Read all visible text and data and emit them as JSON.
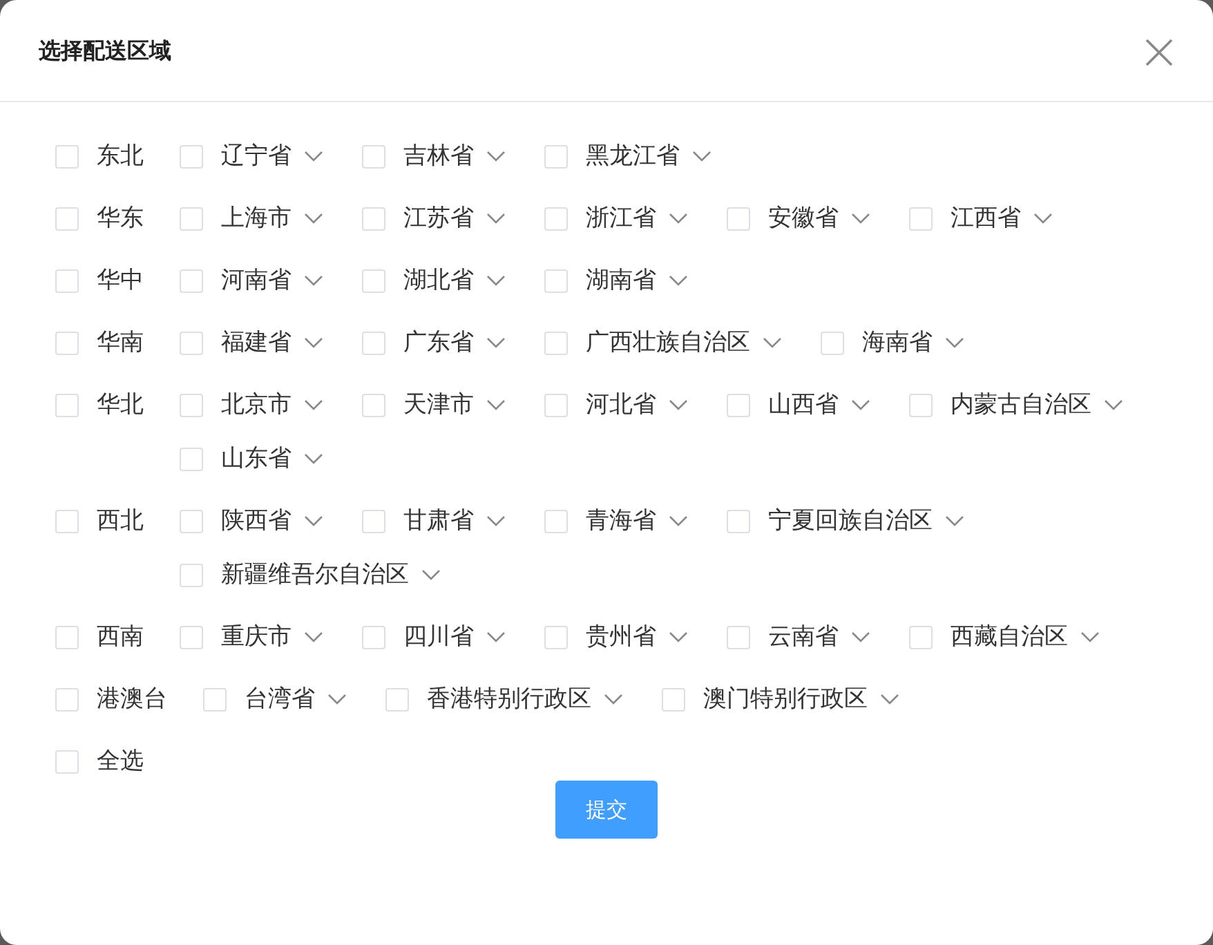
{
  "dialog": {
    "title": "选择配送区域"
  },
  "regions": [
    {
      "label": "东北",
      "checked": false,
      "provinces": [
        {
          "label": "辽宁省",
          "checked": false
        },
        {
          "label": "吉林省",
          "checked": false
        },
        {
          "label": "黑龙江省",
          "checked": false
        }
      ]
    },
    {
      "label": "华东",
      "checked": false,
      "provinces": [
        {
          "label": "上海市",
          "checked": false
        },
        {
          "label": "江苏省",
          "checked": false
        },
        {
          "label": "浙江省",
          "checked": false
        },
        {
          "label": "安徽省",
          "checked": false
        },
        {
          "label": "江西省",
          "checked": false
        }
      ]
    },
    {
      "label": "华中",
      "checked": false,
      "provinces": [
        {
          "label": "河南省",
          "checked": false
        },
        {
          "label": "湖北省",
          "checked": false
        },
        {
          "label": "湖南省",
          "checked": false
        }
      ]
    },
    {
      "label": "华南",
      "checked": false,
      "provinces": [
        {
          "label": "福建省",
          "checked": false
        },
        {
          "label": "广东省",
          "checked": false
        },
        {
          "label": "广西壮族自治区",
          "checked": false
        },
        {
          "label": "海南省",
          "checked": false
        }
      ]
    },
    {
      "label": "华北",
      "checked": false,
      "provinces": [
        {
          "label": "北京市",
          "checked": false
        },
        {
          "label": "天津市",
          "checked": false
        },
        {
          "label": "河北省",
          "checked": false
        },
        {
          "label": "山西省",
          "checked": false
        },
        {
          "label": "内蒙古自治区",
          "checked": false
        },
        {
          "label": "山东省",
          "checked": false
        }
      ]
    },
    {
      "label": "西北",
      "checked": false,
      "provinces": [
        {
          "label": "陕西省",
          "checked": false
        },
        {
          "label": "甘肃省",
          "checked": false
        },
        {
          "label": "青海省",
          "checked": false
        },
        {
          "label": "宁夏回族自治区",
          "checked": false
        },
        {
          "label": "新疆维吾尔自治区",
          "checked": false
        }
      ]
    },
    {
      "label": "西南",
      "checked": false,
      "provinces": [
        {
          "label": "重庆市",
          "checked": false
        },
        {
          "label": "四川省",
          "checked": false
        },
        {
          "label": "贵州省",
          "checked": false
        },
        {
          "label": "云南省",
          "checked": false
        },
        {
          "label": "西藏自治区",
          "checked": false
        }
      ]
    },
    {
      "label": "港澳台",
      "checked": false,
      "provinces": [
        {
          "label": "台湾省",
          "checked": false
        },
        {
          "label": "香港特别行政区",
          "checked": false
        },
        {
          "label": "澳门特别行政区",
          "checked": false
        }
      ]
    }
  ],
  "select_all": {
    "label": "全选",
    "checked": false
  },
  "submit_button": {
    "label": "提交"
  }
}
